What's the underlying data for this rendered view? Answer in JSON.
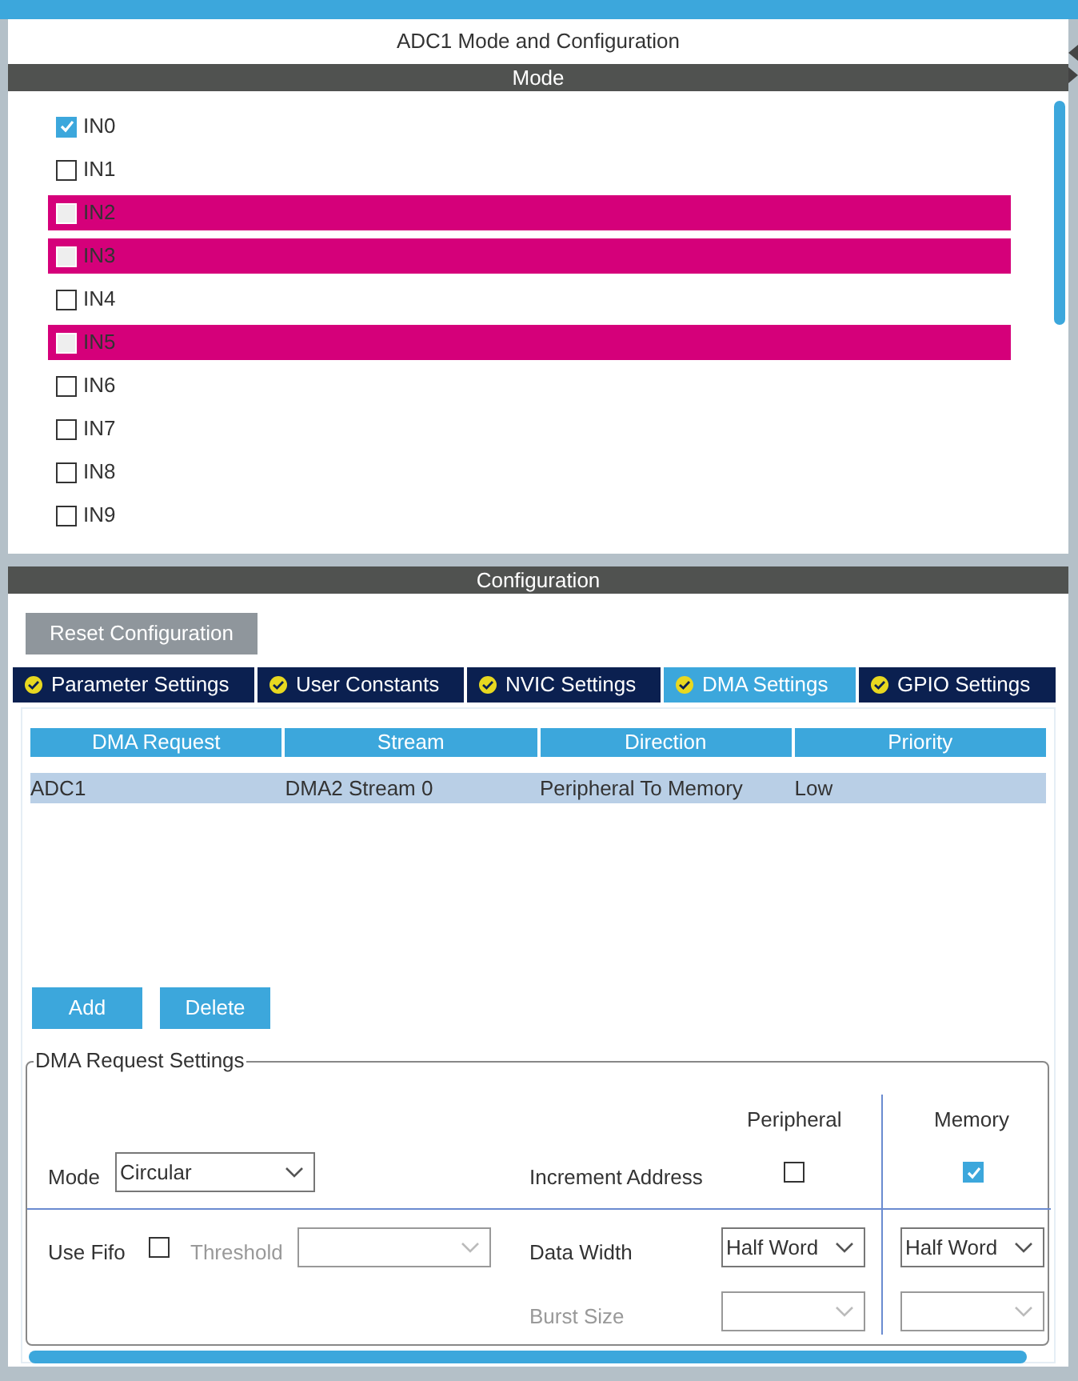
{
  "panel_title": "ADC1 Mode and Configuration",
  "mode": {
    "header": "Mode",
    "channels": [
      {
        "label": "IN0",
        "checked": true,
        "highlighted": false
      },
      {
        "label": "IN1",
        "checked": false,
        "highlighted": false
      },
      {
        "label": "IN2",
        "checked": false,
        "highlighted": true
      },
      {
        "label": "IN3",
        "checked": false,
        "highlighted": true
      },
      {
        "label": "IN4",
        "checked": false,
        "highlighted": false
      },
      {
        "label": "IN5",
        "checked": false,
        "highlighted": true
      },
      {
        "label": "IN6",
        "checked": false,
        "highlighted": false
      },
      {
        "label": "IN7",
        "checked": false,
        "highlighted": false
      },
      {
        "label": "IN8",
        "checked": false,
        "highlighted": false
      },
      {
        "label": "IN9",
        "checked": false,
        "highlighted": false
      }
    ]
  },
  "configuration": {
    "header": "Configuration",
    "reset_button": "Reset Configuration",
    "tabs": [
      {
        "label": "Parameter Settings",
        "selected": false
      },
      {
        "label": "User Constants",
        "selected": false
      },
      {
        "label": "NVIC Settings",
        "selected": false
      },
      {
        "label": "DMA Settings",
        "selected": true
      },
      {
        "label": "GPIO Settings",
        "selected": false
      }
    ],
    "table": {
      "columns": [
        "DMA Request",
        "Stream",
        "Direction",
        "Priority"
      ],
      "rows": [
        [
          "ADC1",
          "DMA2 Stream 0",
          "Peripheral To Memory",
          "Low"
        ]
      ]
    },
    "buttons": [
      "Add",
      "Delete"
    ],
    "settings": {
      "title": "DMA Request Settings",
      "peripheral_header": "Peripheral",
      "memory_header": "Memory",
      "mode_label": "Mode",
      "mode_value": "Circular",
      "increment_label": "Increment Address",
      "peripheral_increment": false,
      "memory_increment": true,
      "use_fifo_label": "Use Fifo",
      "use_fifo": false,
      "threshold_label": "Threshold",
      "data_width_label": "Data Width",
      "peripheral_data_width": "Half Word",
      "memory_data_width": "Half Word",
      "burst_size_label": "Burst Size"
    }
  }
}
